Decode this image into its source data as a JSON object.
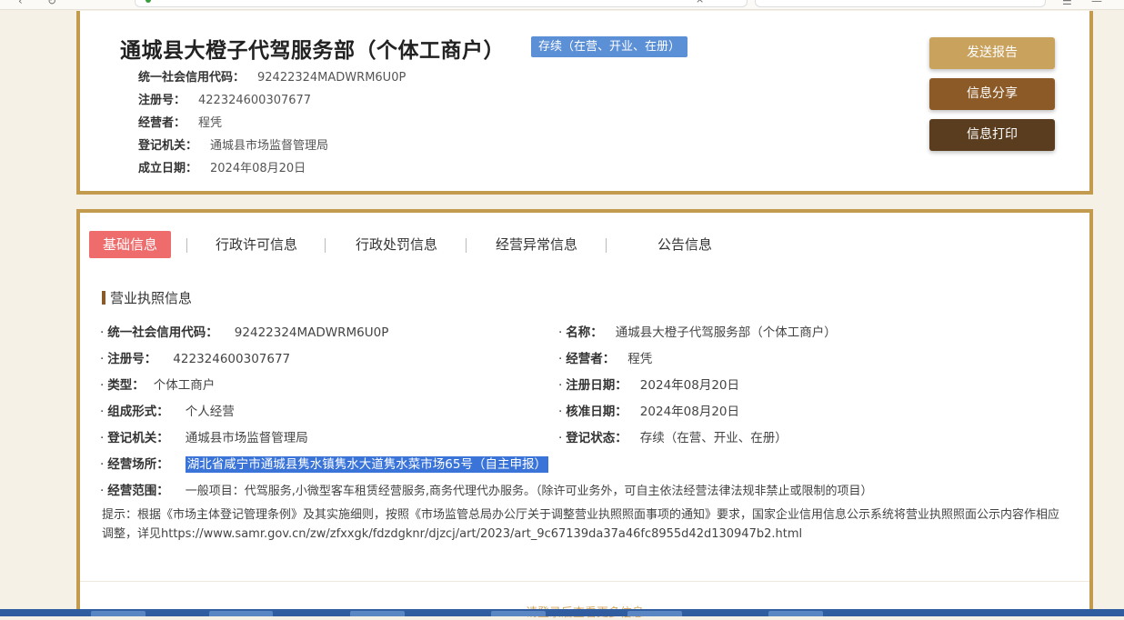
{
  "company": {
    "name": "通城县大橙子代驾服务部（个体工商户）",
    "status_badge": "存续（在营、开业、在册）",
    "credit_code_label": "统一社会信用代码：",
    "credit_code": "92422324MADWRM6U0P",
    "reg_no_label": "注册号：",
    "reg_no": "422324600307677",
    "operator_label": "经营者：",
    "operator": "程凭",
    "authority_label": "登记机关：",
    "authority": "通城县市场监督管理局",
    "founded_label": "成立日期：",
    "founded": "2024年08月20日"
  },
  "actions": {
    "send_report": "发送报告",
    "share": "信息分享",
    "print": "信息打印"
  },
  "tabs": [
    {
      "label": "基础信息"
    },
    {
      "label": "行政许可信息"
    },
    {
      "label": "行政处罚信息"
    },
    {
      "label": "经营异常信息"
    },
    {
      "label": "公告信息"
    }
  ],
  "license": {
    "section_title": "营业执照信息",
    "left": [
      {
        "label": "统一社会信用代码：",
        "value": "92422324MADWRM6U0P"
      },
      {
        "label": "注册号：",
        "value": "422324600307677"
      },
      {
        "label": "类型：",
        "value": "个体工商户"
      },
      {
        "label": "组成形式：",
        "value": "个人经营"
      },
      {
        "label": "登记机关：",
        "value": "通城县市场监督管理局"
      },
      {
        "label": "经营场所：",
        "value": "湖北省咸宁市通城县隽水镇隽水大道隽水菜市场65号（自主申报）"
      },
      {
        "label": "经营范围：",
        "value": "一般项目：代驾服务,小微型客车租赁经营服务,商务代理代办服务。（除许可业务外，可自主依法经营法律法规非禁止或限制的项目）"
      }
    ],
    "right": [
      {
        "label": "名称：",
        "value": "通城县大橙子代驾服务部（个体工商户）"
      },
      {
        "label": "经营者：",
        "value": "程凭"
      },
      {
        "label": "注册日期：",
        "value": "2024年08月20日"
      },
      {
        "label": "核准日期：",
        "value": "2024年08月20日"
      },
      {
        "label": "登记状态：",
        "value": "存续（在营、开业、在册）"
      }
    ],
    "bullet": "·",
    "tip": "提示：根据《市场主体登记管理条例》及其实施细则，按照《市场监管总局办公厅关于调整营业执照照面事项的通知》要求，国家企业信用信息公示系统将营业执照照面公示内容作相应调整，详见https://www.samr.gov.cn/zw/zfxxgk/fdzdgknr/djzcj/art/2023/art_9c67139da37a46fc8955d42d130947b2.html"
  },
  "footer": {
    "login_more": "请登录后查看更多信息"
  },
  "colors": {
    "border_gold": "#c39b4f",
    "btn_send": "#c9a25e",
    "btn_share": "#8c5a27",
    "btn_print": "#5a3d1e",
    "tab_active": "#ef6c6c",
    "badge": "#5b8fd6"
  }
}
